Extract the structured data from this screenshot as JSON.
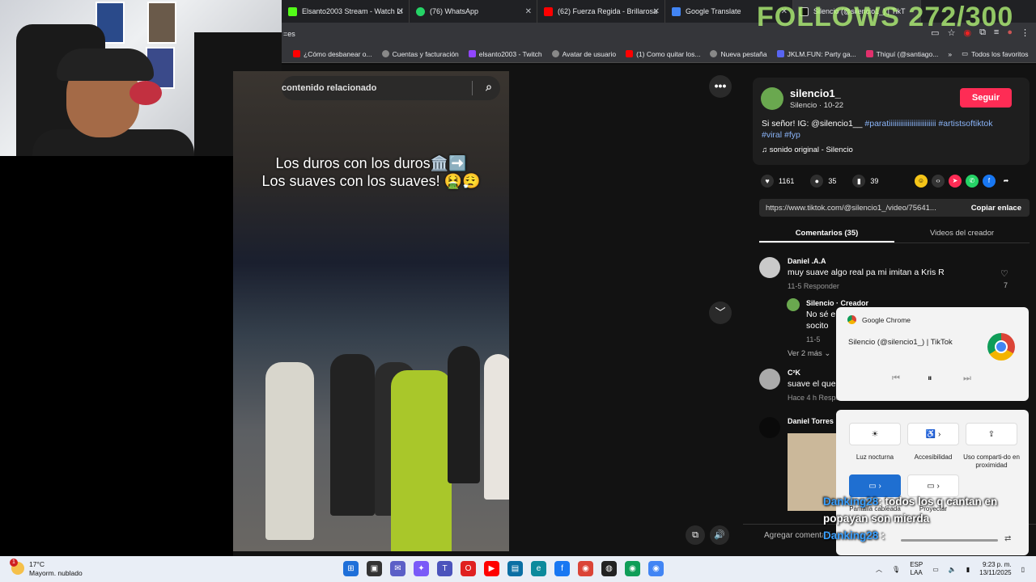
{
  "browser": {
    "tabs": [
      {
        "title": "Elsanto2003 Stream - Watch Li",
        "color": "#53fc18",
        "active": false
      },
      {
        "title": "(76) WhatsApp",
        "color": "#25d366",
        "active": false
      },
      {
        "title": "(62) Fuerza Regida - Brillarosa",
        "color": "#ff0000",
        "active": false
      },
      {
        "title": "Google Translate",
        "color": "#4285f4",
        "active": false
      },
      {
        "title": "Silencio (@silencio1_) | TikT",
        "color": "#111111",
        "active": true
      }
    ],
    "address": "=es",
    "bookmarks": [
      {
        "label": "¿Cómo desbanear o...",
        "color": "#ff0000"
      },
      {
        "label": "Cuentas y facturación",
        "color": "#888888"
      },
      {
        "label": "elsanto2003 - Twitch",
        "color": "#9146ff"
      },
      {
        "label": "Avatar de usuario",
        "color": "#888888"
      },
      {
        "label": "(1) Como quitar los...",
        "color": "#ff0000"
      },
      {
        "label": "Nueva pestaña",
        "color": "#888888"
      },
      {
        "label": "JKLM.FUN: Party ga...",
        "color": "#5865f2"
      },
      {
        "label": "Thiguí (@santiago...",
        "color": "#e1306c"
      }
    ],
    "all_bookmarks": "Todos los favoritos"
  },
  "overlay": {
    "follows": "FOLLOWS 272/300"
  },
  "video": {
    "search_placeholder": "contenido relacionado",
    "caption_line1": "Los duros con los duros🏛️➡️",
    "caption_line2": "Los suaves con los suaves! 🤮😮‍💨"
  },
  "creator": {
    "name": "silencio1_",
    "sub": "Silencio · 10-22",
    "follow": "Seguir",
    "desc_text": "Si señor! IG: @silencio1__ ",
    "desc_tags": "#paratiiiiiiiiiiiiiiiiiiiiiiiii #artistsoftiktok #viral #fyp",
    "sound": "♫  sonido original - Silencio"
  },
  "stats": {
    "likes": "1161",
    "comments": "35",
    "saves": "39"
  },
  "link": {
    "url": "https://www.tiktok.com/@silencio1_/video/75641...",
    "copy": "Copiar enlace"
  },
  "tabs": {
    "comments": "Comentarios (35)",
    "creator_videos": "Videos del creador"
  },
  "comments": [
    {
      "name": "Daniel .A.A",
      "text": "muy suave algo real pa mi imitan a Kris R",
      "meta": "11-5     Responder",
      "likes": "7"
    },
    {
      "name": "Silencio · Creador",
      "text": "No sé e",
      "text2": "socito",
      "meta": "11-5"
    },
    {
      "more": "Ver 2 más ⌄"
    },
    {
      "name": "C²K",
      "text": "suave el que",
      "meta": "Hace 4 h     Responder"
    },
    {
      "name": "Daniel Torres"
    }
  ],
  "add_comment": "Agregar comentario...",
  "chrome_popup": {
    "title": "Google Chrome",
    "media": "Silencio (@silencio1_) | TikTok"
  },
  "quick_settings": {
    "night": "Luz nocturna",
    "access": "Accesibilidad",
    "nearby": "Uso comparti-do en proximidad",
    "screen": "Pantalla cableada",
    "project": "Proyectar"
  },
  "chat": {
    "user": "Danking28",
    "msg": ": todos los q cantan en popayan son mierda",
    "user2": "Danking28",
    "msg2": ":"
  },
  "taskbar": {
    "temp": "17°C",
    "weather": "Mayorm. nublado",
    "lang1": "ESP",
    "lang2": "LAA",
    "time": "9:23 p. m.",
    "date": "13/11/2025",
    "badge": "1"
  }
}
